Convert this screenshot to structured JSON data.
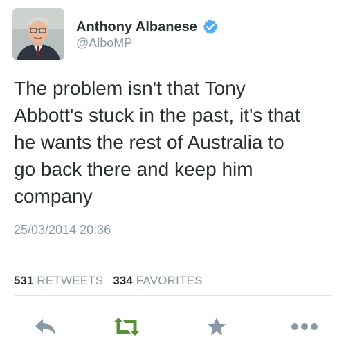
{
  "author": {
    "name": "Anthony Albanese",
    "handle": "@AlboMP",
    "verified": true
  },
  "tweet": {
    "text_lines": [
      "The problem isn't that Tony",
      "Abbott's stuck in the past, it's that",
      "he wants the rest of Australia to",
      "go back there and keep him",
      "company"
    ],
    "timestamp": "25/03/2014 20:36"
  },
  "stats": {
    "retweets_count": "531",
    "retweets_label": "RETWEETS",
    "favorites_count": "334",
    "favorites_label": "FAVORITES"
  },
  "actions": [
    {
      "name": "reply",
      "icon": "reply-icon"
    },
    {
      "name": "retweet",
      "icon": "retweet-icon"
    },
    {
      "name": "favorite",
      "icon": "star-icon"
    },
    {
      "name": "more",
      "icon": "more-icon"
    }
  ],
  "colors": {
    "text": "#292f33",
    "secondary_text": "#8899a6",
    "verified_blue": "#55acee",
    "retweet_green": "#5c913b",
    "action_gray": "#8899a6",
    "divider": "#dde3e8"
  }
}
